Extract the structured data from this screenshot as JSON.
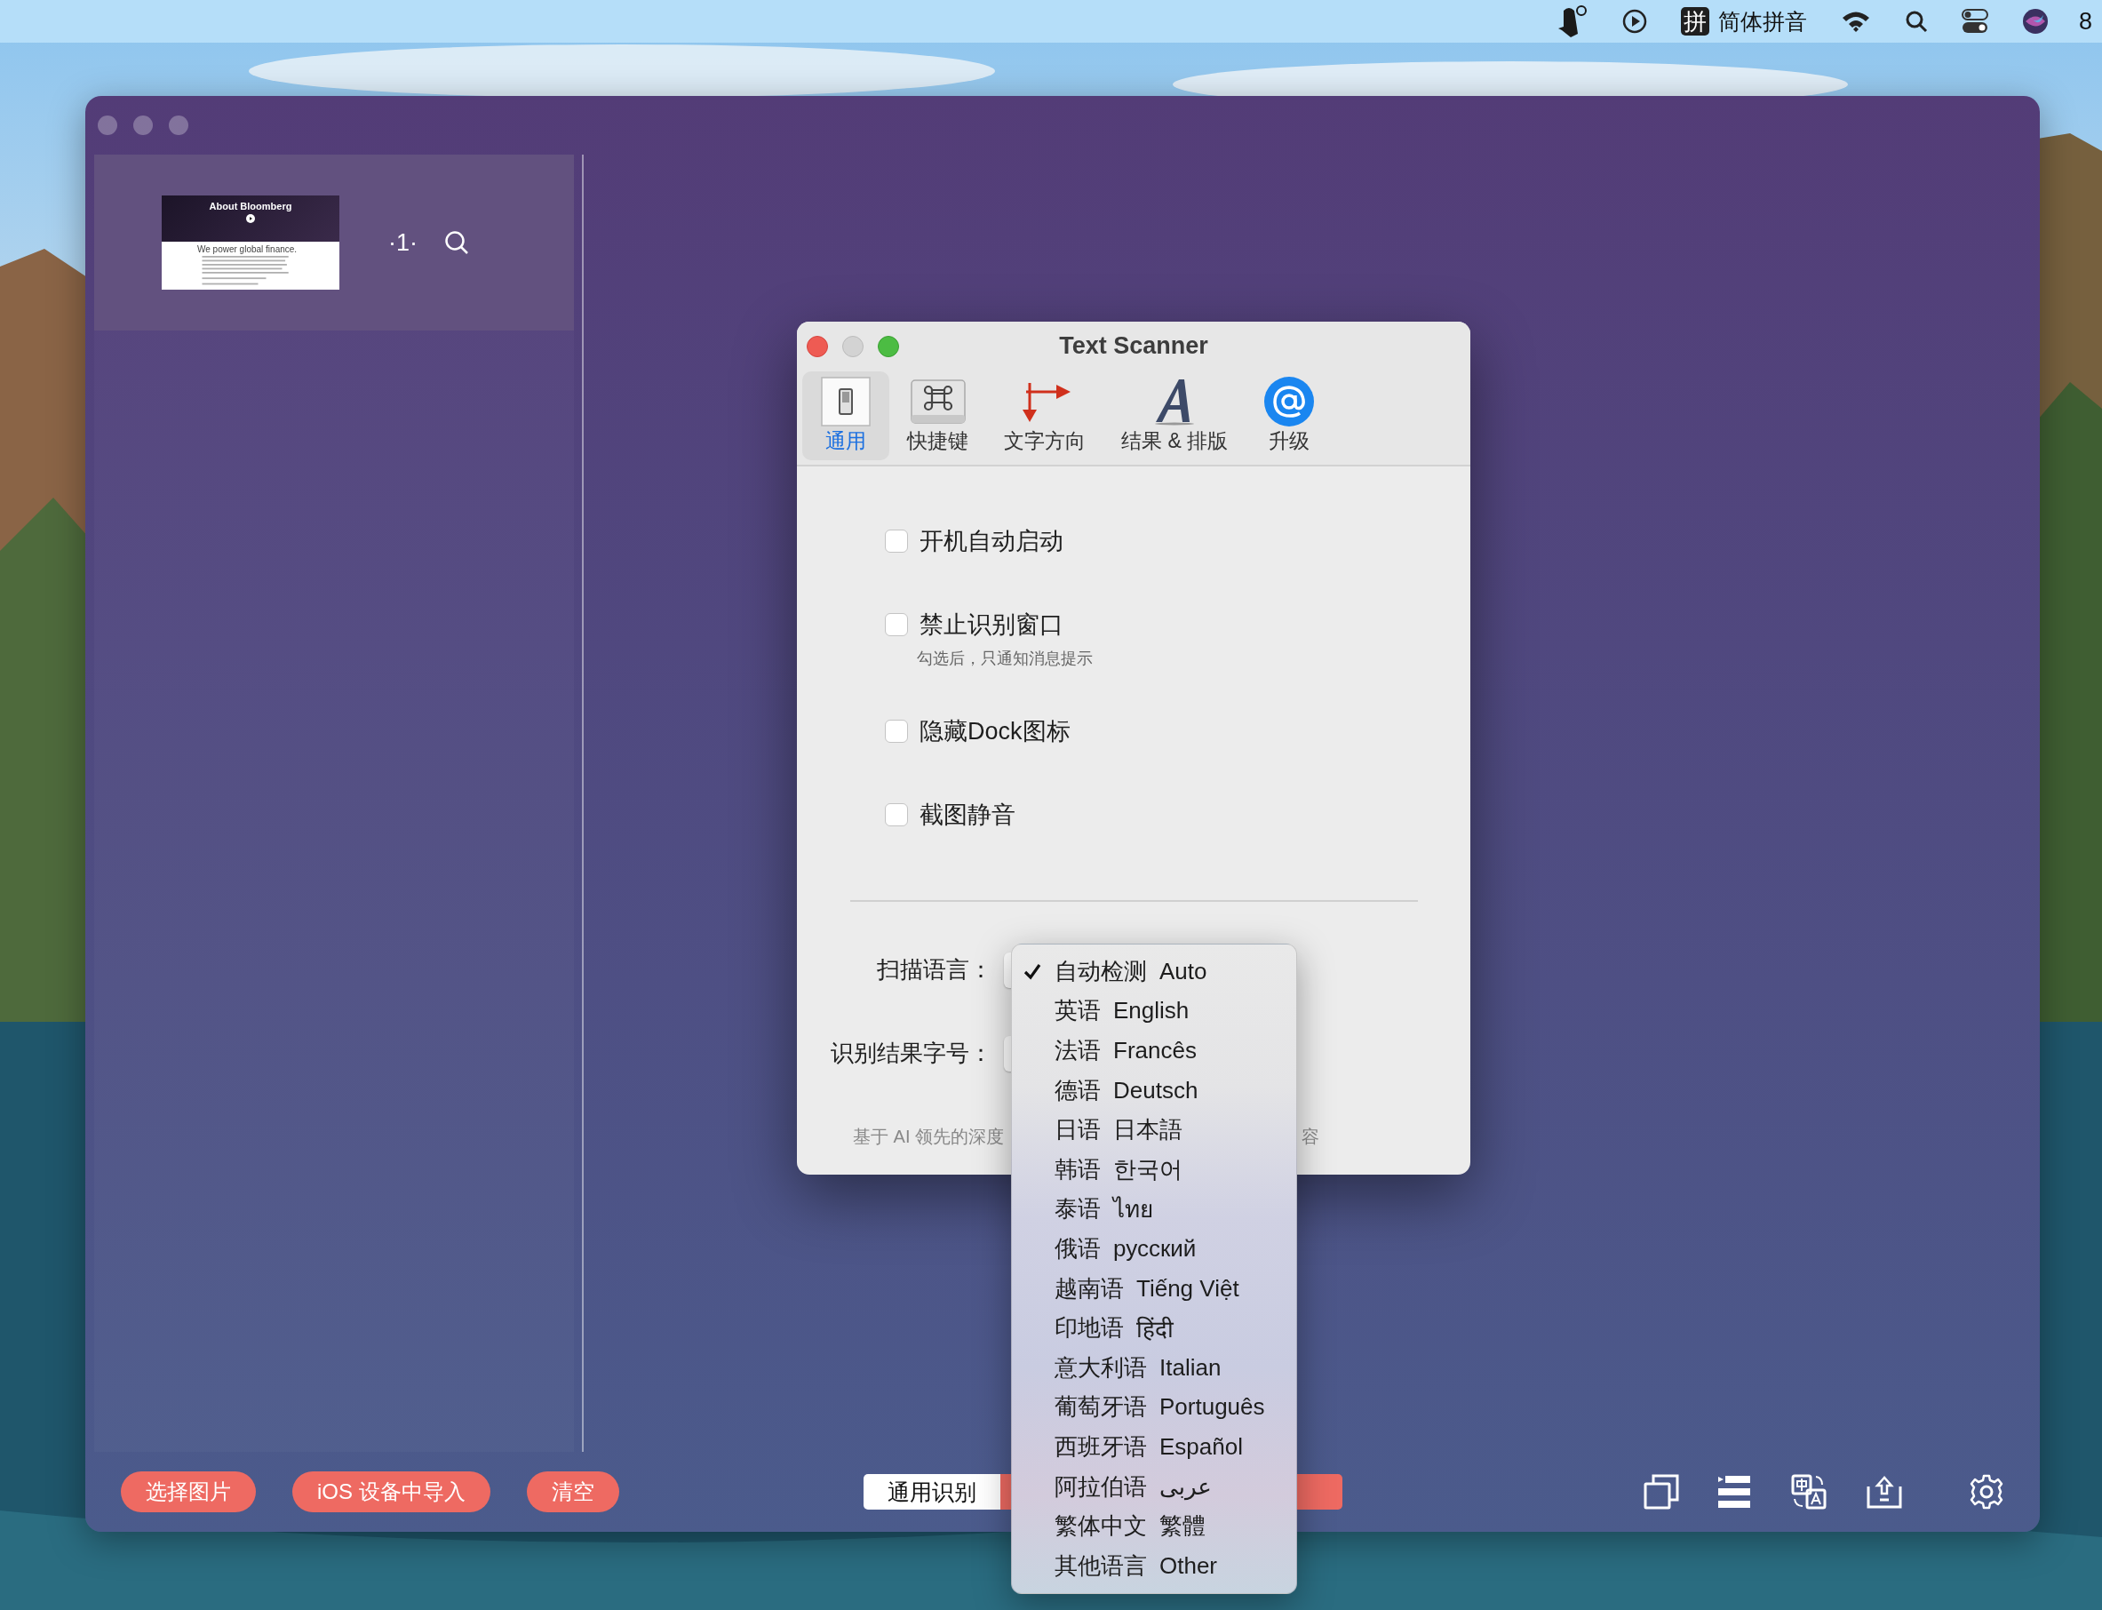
{
  "menu_bar": {
    "input_method_badge": "拼",
    "input_method": "简体拼音",
    "clock": "8"
  },
  "main_window": {
    "thumbnails": [
      {
        "title": "About Bloomberg",
        "heading": "We power global finance.",
        "page": "·1·",
        "selected": true
      }
    ],
    "buttons": [
      "选择图片",
      "iOS 设备中导入",
      "清空"
    ],
    "mode_segment": {
      "label": "通用识别"
    }
  },
  "dialog": {
    "title": "Text Scanner",
    "tabs": [
      {
        "kind": "switch",
        "label": "通用",
        "selected": true
      },
      {
        "kind": "command",
        "label": "快捷键",
        "selected": false
      },
      {
        "kind": "direction",
        "label": "文字方向",
        "selected": false
      },
      {
        "kind": "letter",
        "label": "结果 & 排版",
        "selected": false
      },
      {
        "kind": "at",
        "label": "升级",
        "selected": false
      }
    ],
    "options": [
      {
        "label": "开机自动启动",
        "checked": false
      },
      {
        "label": "禁止识别窗口",
        "checked": false,
        "hint": "勾选后，只通知消息提示"
      },
      {
        "label": "隐藏Dock图标",
        "checked": false
      },
      {
        "label": "截图静音",
        "checked": false
      }
    ],
    "scan_language_label": "扫描语言：",
    "font_size_label": "识别结果字号：",
    "footer_left": "基于 AI 领先的深度",
    "footer_right": "容"
  },
  "language_menu": [
    {
      "native": "自动检测",
      "name": "Auto",
      "selected": true
    },
    {
      "native": "英语",
      "name": "English",
      "selected": false
    },
    {
      "native": "法语",
      "name": "Francês",
      "selected": false
    },
    {
      "native": "德语",
      "name": "Deutsch",
      "selected": false
    },
    {
      "native": "日语",
      "name": "日本語",
      "selected": false
    },
    {
      "native": "韩语",
      "name": "한국어",
      "selected": false
    },
    {
      "native": "泰语",
      "name": "ไทย",
      "selected": false
    },
    {
      "native": "俄语",
      "name": "русский",
      "selected": false
    },
    {
      "native": "越南语",
      "name": "Tiếng Việt",
      "selected": false
    },
    {
      "native": "印地语",
      "name": "हिंदी",
      "selected": false
    },
    {
      "native": "意大利语",
      "name": "Italian",
      "selected": false
    },
    {
      "native": "葡萄牙语",
      "name": "Português",
      "selected": false
    },
    {
      "native": "西班牙语",
      "name": "Español",
      "selected": false
    },
    {
      "native": "阿拉伯语",
      "name": "عربى",
      "selected": false
    },
    {
      "native": "繁体中文",
      "name": "繁體",
      "selected": false
    },
    {
      "native": "其他语言",
      "name": "Other",
      "selected": false
    }
  ]
}
